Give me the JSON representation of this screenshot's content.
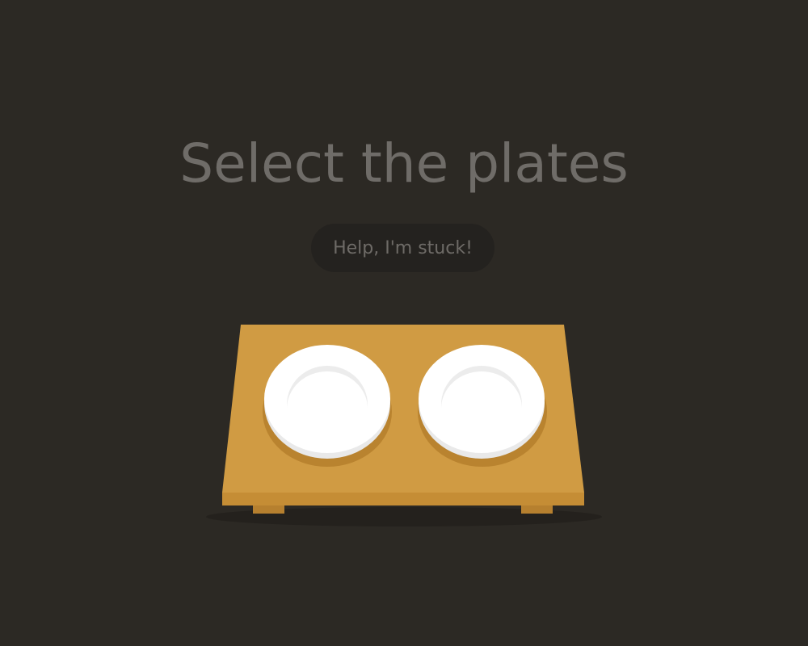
{
  "level": {
    "instruction": "Select the plates"
  },
  "help": {
    "label": "Help, I'm stuck!"
  },
  "table": {
    "plates": [
      {
        "selector": "plate"
      },
      {
        "selector": "plate"
      }
    ]
  },
  "colors": {
    "background": "#2c2924",
    "instruction_text": "#6f6c68",
    "help_button_bg": "#24221f",
    "help_button_text": "#6e6b67",
    "table_top": "#d09b43",
    "table_front": "#c58d35",
    "table_leg": "#b6802f",
    "plate": "#ffffff",
    "plate_rim": "#e9e9e9"
  }
}
